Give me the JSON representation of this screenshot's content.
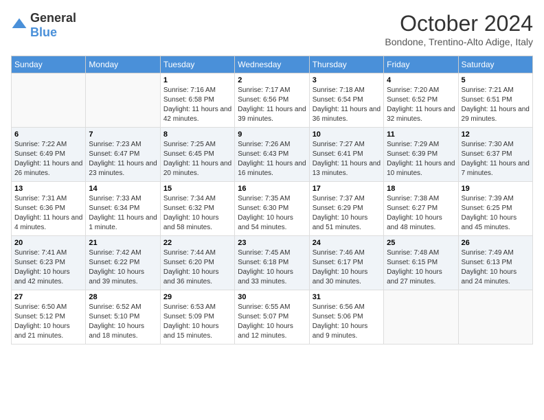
{
  "header": {
    "logo": {
      "general": "General",
      "blue": "Blue"
    },
    "title": "October 2024",
    "location": "Bondone, Trentino-Alto Adige, Italy"
  },
  "calendar": {
    "days_of_week": [
      "Sunday",
      "Monday",
      "Tuesday",
      "Wednesday",
      "Thursday",
      "Friday",
      "Saturday"
    ],
    "weeks": [
      [
        {
          "day": "",
          "info": ""
        },
        {
          "day": "",
          "info": ""
        },
        {
          "day": "1",
          "info": "Sunrise: 7:16 AM\nSunset: 6:58 PM\nDaylight: 11 hours and 42 minutes."
        },
        {
          "day": "2",
          "info": "Sunrise: 7:17 AM\nSunset: 6:56 PM\nDaylight: 11 hours and 39 minutes."
        },
        {
          "day": "3",
          "info": "Sunrise: 7:18 AM\nSunset: 6:54 PM\nDaylight: 11 hours and 36 minutes."
        },
        {
          "day": "4",
          "info": "Sunrise: 7:20 AM\nSunset: 6:52 PM\nDaylight: 11 hours and 32 minutes."
        },
        {
          "day": "5",
          "info": "Sunrise: 7:21 AM\nSunset: 6:51 PM\nDaylight: 11 hours and 29 minutes."
        }
      ],
      [
        {
          "day": "6",
          "info": "Sunrise: 7:22 AM\nSunset: 6:49 PM\nDaylight: 11 hours and 26 minutes."
        },
        {
          "day": "7",
          "info": "Sunrise: 7:23 AM\nSunset: 6:47 PM\nDaylight: 11 hours and 23 minutes."
        },
        {
          "day": "8",
          "info": "Sunrise: 7:25 AM\nSunset: 6:45 PM\nDaylight: 11 hours and 20 minutes."
        },
        {
          "day": "9",
          "info": "Sunrise: 7:26 AM\nSunset: 6:43 PM\nDaylight: 11 hours and 16 minutes."
        },
        {
          "day": "10",
          "info": "Sunrise: 7:27 AM\nSunset: 6:41 PM\nDaylight: 11 hours and 13 minutes."
        },
        {
          "day": "11",
          "info": "Sunrise: 7:29 AM\nSunset: 6:39 PM\nDaylight: 11 hours and 10 minutes."
        },
        {
          "day": "12",
          "info": "Sunrise: 7:30 AM\nSunset: 6:37 PM\nDaylight: 11 hours and 7 minutes."
        }
      ],
      [
        {
          "day": "13",
          "info": "Sunrise: 7:31 AM\nSunset: 6:36 PM\nDaylight: 11 hours and 4 minutes."
        },
        {
          "day": "14",
          "info": "Sunrise: 7:33 AM\nSunset: 6:34 PM\nDaylight: 11 hours and 1 minute."
        },
        {
          "day": "15",
          "info": "Sunrise: 7:34 AM\nSunset: 6:32 PM\nDaylight: 10 hours and 58 minutes."
        },
        {
          "day": "16",
          "info": "Sunrise: 7:35 AM\nSunset: 6:30 PM\nDaylight: 10 hours and 54 minutes."
        },
        {
          "day": "17",
          "info": "Sunrise: 7:37 AM\nSunset: 6:29 PM\nDaylight: 10 hours and 51 minutes."
        },
        {
          "day": "18",
          "info": "Sunrise: 7:38 AM\nSunset: 6:27 PM\nDaylight: 10 hours and 48 minutes."
        },
        {
          "day": "19",
          "info": "Sunrise: 7:39 AM\nSunset: 6:25 PM\nDaylight: 10 hours and 45 minutes."
        }
      ],
      [
        {
          "day": "20",
          "info": "Sunrise: 7:41 AM\nSunset: 6:23 PM\nDaylight: 10 hours and 42 minutes."
        },
        {
          "day": "21",
          "info": "Sunrise: 7:42 AM\nSunset: 6:22 PM\nDaylight: 10 hours and 39 minutes."
        },
        {
          "day": "22",
          "info": "Sunrise: 7:44 AM\nSunset: 6:20 PM\nDaylight: 10 hours and 36 minutes."
        },
        {
          "day": "23",
          "info": "Sunrise: 7:45 AM\nSunset: 6:18 PM\nDaylight: 10 hours and 33 minutes."
        },
        {
          "day": "24",
          "info": "Sunrise: 7:46 AM\nSunset: 6:17 PM\nDaylight: 10 hours and 30 minutes."
        },
        {
          "day": "25",
          "info": "Sunrise: 7:48 AM\nSunset: 6:15 PM\nDaylight: 10 hours and 27 minutes."
        },
        {
          "day": "26",
          "info": "Sunrise: 7:49 AM\nSunset: 6:13 PM\nDaylight: 10 hours and 24 minutes."
        }
      ],
      [
        {
          "day": "27",
          "info": "Sunrise: 6:50 AM\nSunset: 5:12 PM\nDaylight: 10 hours and 21 minutes."
        },
        {
          "day": "28",
          "info": "Sunrise: 6:52 AM\nSunset: 5:10 PM\nDaylight: 10 hours and 18 minutes."
        },
        {
          "day": "29",
          "info": "Sunrise: 6:53 AM\nSunset: 5:09 PM\nDaylight: 10 hours and 15 minutes."
        },
        {
          "day": "30",
          "info": "Sunrise: 6:55 AM\nSunset: 5:07 PM\nDaylight: 10 hours and 12 minutes."
        },
        {
          "day": "31",
          "info": "Sunrise: 6:56 AM\nSunset: 5:06 PM\nDaylight: 10 hours and 9 minutes."
        },
        {
          "day": "",
          "info": ""
        },
        {
          "day": "",
          "info": ""
        }
      ]
    ]
  }
}
